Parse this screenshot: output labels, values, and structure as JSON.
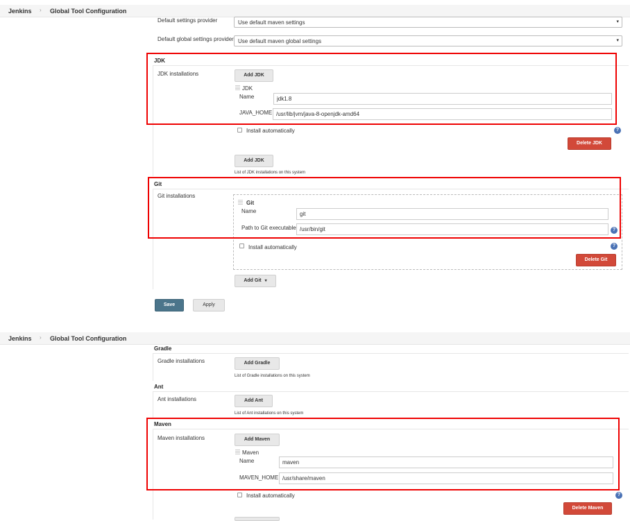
{
  "breadcrumb": {
    "home": "Jenkins",
    "separator": "›",
    "page": "Global Tool Configuration"
  },
  "maven_settings": {
    "settings_label": "Default settings provider",
    "settings_value": "Use default maven settings",
    "global_label": "Default global settings provider",
    "global_value": "Use default maven global settings"
  },
  "jdk": {
    "title": "JDK",
    "installations_label": "JDK installations",
    "add_label": "Add JDK",
    "item_title": "JDK",
    "name_label": "Name",
    "name_value": "jdk1.8",
    "home_label": "JAVA_HOME",
    "home_value": "/usr/lib/jvm/java-8-openjdk-amd64",
    "install_auto_label": "Install automatically",
    "delete_label": "Delete JDK",
    "list_note": "List of JDK installations on this system"
  },
  "git": {
    "title": "Git",
    "installations_label": "Git installations",
    "item_title": "Git",
    "name_label": "Name",
    "name_value": "git",
    "path_label": "Path to Git executable",
    "path_value": "/usr/bin/git",
    "install_auto_label": "Install automatically",
    "delete_label": "Delete Git",
    "add_label": "Add Git"
  },
  "actions": {
    "save_label": "Save",
    "apply_label": "Apply"
  },
  "gradle": {
    "title": "Gradle",
    "installations_label": "Gradle installations",
    "add_label": "Add Gradle",
    "list_note": "List of Gradle installations on this system"
  },
  "ant": {
    "title": "Ant",
    "installations_label": "Ant installations",
    "add_label": "Add Ant",
    "list_note": "List of Ant installations on this system"
  },
  "maven": {
    "title": "Maven",
    "installations_label": "Maven installations",
    "add_label": "Add Maven",
    "item_title": "Maven",
    "name_label": "Name",
    "name_value": "maven",
    "home_label": "MAVEN_HOME",
    "home_value": "/usr/share/maven",
    "install_auto_label": "Install automatically",
    "delete_label": "Delete Maven"
  },
  "help_glyph": "?",
  "dropdown_glyph": "▾",
  "colors": {
    "save": "#4b758b",
    "delete": "#d24939",
    "highlight": "#ee0000",
    "help": "#4a72b5"
  }
}
